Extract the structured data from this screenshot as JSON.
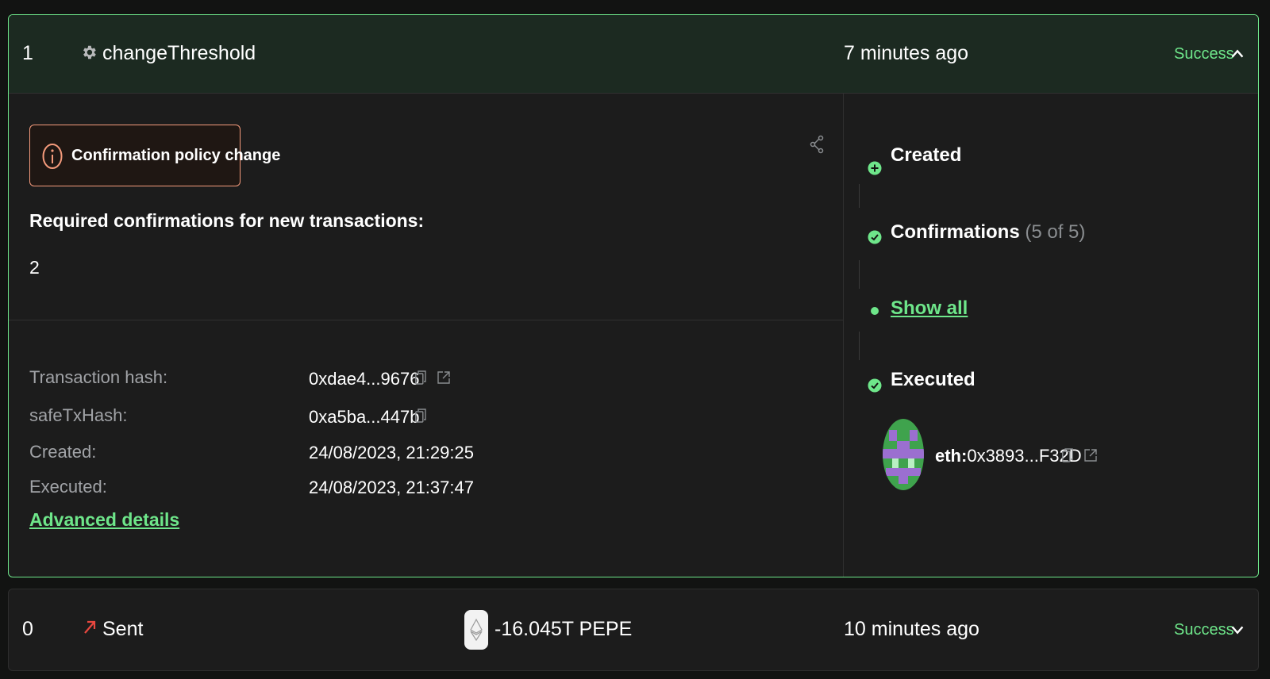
{
  "expanded_tx": {
    "nonce": "1",
    "type_icon": "gear-icon",
    "type_label": "changeThreshold",
    "time": "7 minutes ago",
    "status": "Success",
    "alert": {
      "icon": "info-icon",
      "text": "Confirmation policy change"
    },
    "required_title": "Required confirmations for new transactions:",
    "required_value": "2",
    "details": [
      {
        "label": "Transaction hash:",
        "value": "0xdae4...9676"
      },
      {
        "label": "safeTxHash:",
        "value": "0xa5ba...447b"
      },
      {
        "label": "Created:",
        "value": "24/08/2023, 21:29:25"
      },
      {
        "label": "Executed:",
        "value": "24/08/2023, 21:37:47"
      }
    ],
    "advanced_link": "Advanced details",
    "steps": {
      "created": "Created",
      "confirmations": "Confirmations",
      "confirmations_count": "(5 of 5)",
      "show_all": "Show all",
      "executed": "Executed"
    },
    "executor": {
      "prefix": "eth:",
      "address": "0x3893...F32D"
    }
  },
  "collapsed_tx": {
    "nonce": "0",
    "type_icon": "arrow-up-right-icon",
    "type_label": "Sent",
    "token_icon": "ethereum-icon",
    "amount": "-16.045T PEPE",
    "time": "10 minutes ago",
    "status": "Success"
  },
  "colors": {
    "accent": "#6ee68a",
    "warning": "#f59b7c",
    "sent": "#e8473f"
  }
}
